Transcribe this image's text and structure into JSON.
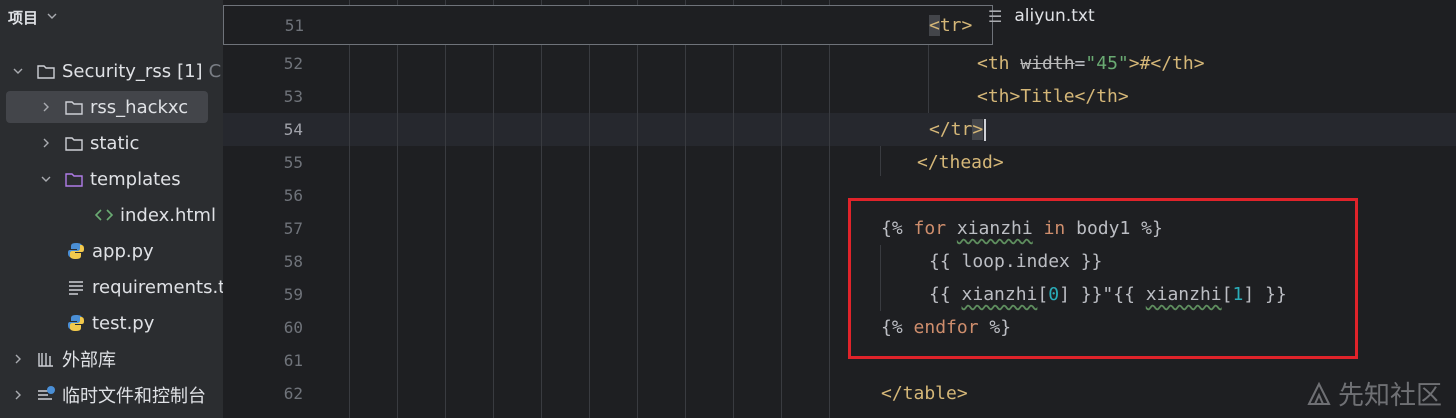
{
  "sidebar": {
    "header": "项目",
    "items": [
      {
        "label": "Security_rss",
        "suffix": "[1]",
        "extra": "C"
      },
      {
        "label": "rss_hackxc"
      },
      {
        "label": "static"
      },
      {
        "label": "templates"
      },
      {
        "label": "index.html"
      },
      {
        "label": "app.py"
      },
      {
        "label": "requirements.t"
      },
      {
        "label": "test.py"
      },
      {
        "label": "外部库"
      },
      {
        "label": "临时文件和控制台"
      }
    ]
  },
  "editor": {
    "tab_hint": "aliyun.txt",
    "line_numbers": [
      "51",
      "52",
      "53",
      "54",
      "55",
      "56",
      "57",
      "58",
      "59",
      "60",
      "61",
      "62"
    ],
    "code": {
      "l51_open": "<",
      "l51_tag": "tr",
      "l51_close": ">",
      "l52_a": "<th ",
      "l52_attr": "width",
      "l52_eq": "=",
      "l52_str": "\"45\"",
      "l52_b": ">#</th>",
      "l53": "<th>Title</th>",
      "l54_a": "</tr",
      "l54_b": ">",
      "l55": "</thead>",
      "l57_a": "{% ",
      "l57_kw1": "for",
      "l57_sp1": " ",
      "l57_var": "xianzhi",
      "l57_sp2": " ",
      "l57_kw2": "in",
      "l57_b": " body1 %}",
      "l58": "{{ loop.index }}",
      "l59_a": "{{ ",
      "l59_var1": "xianzhi",
      "l59_b": "[",
      "l59_n1": "0",
      "l59_c": "] }}\"{{ ",
      "l59_var2": "xianzhi",
      "l59_d": "[",
      "l59_n2": "1",
      "l59_e": "] }}",
      "l60_a": "{% ",
      "l60_kw": "endfor",
      "l60_b": " %}",
      "l62": "</table>"
    }
  },
  "watermark": "先知社区",
  "colors": {
    "highlight_box": "#e0232a",
    "folder_templates": "#b07ce8",
    "html_icon": "#6aab73"
  }
}
